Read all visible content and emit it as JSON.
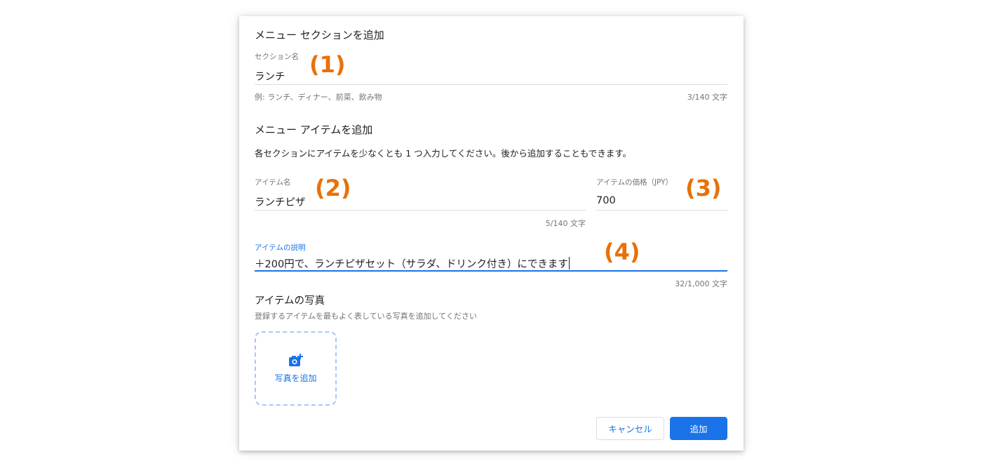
{
  "colors": {
    "accent": "#1a73e8",
    "annotation": "#e8710a",
    "label_gray": "#70757a",
    "divider": "#dadce0"
  },
  "dialog": {
    "section_title": "メニュー セクションを追加",
    "section_field": {
      "label": "セクション名",
      "value": "ランチ",
      "hint": "例: ランチ、ディナー、前菜、飲み物",
      "counter": "3/140 文字"
    },
    "item_title": "メニュー アイテムを追加",
    "item_instructions": "各セクションにアイテムを少なくとも 1 つ入力してください。後から追加することもできます。",
    "item_name_field": {
      "label": "アイテム名",
      "value": "ランチピザ",
      "counter": "5/140 文字"
    },
    "item_price_field": {
      "label": "アイテムの価格（JPY）",
      "value": "700"
    },
    "item_description_field": {
      "label": "アイテムの説明",
      "value": "＋200円で、ランチピザセット（サラダ、ドリンク付き）にできます",
      "counter": "32/1,000 文字"
    },
    "photo_section": {
      "title": "アイテムの写真",
      "subtitle": "登録するアイテムを最もよく表している写真を追加してください",
      "add_photo_label": "写真を追加",
      "icon": "add-photo-icon"
    },
    "buttons": {
      "cancel": "キャンセル",
      "add": "追加"
    }
  },
  "annotations": {
    "a1": "(1)",
    "a2": "(2)",
    "a3": "(3)",
    "a4": "(4)"
  }
}
